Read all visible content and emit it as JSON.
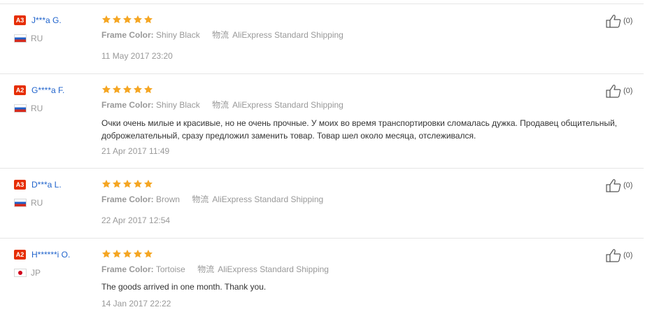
{
  "reviews": [
    {
      "level": "A3",
      "user": "J***a G.",
      "country": "RU",
      "flag_icon": "russia-flag-icon",
      "rating": 5,
      "attr_label": "Frame Color:",
      "attr_value": "Shiny Black",
      "shipping_label": "物流",
      "shipping_value": "AliExpress Standard Shipping",
      "text": "",
      "date": "11 May 2017 23:20",
      "helpful_count": "(0)"
    },
    {
      "level": "A2",
      "user": "G****a F.",
      "country": "RU",
      "flag_icon": "russia-flag-icon",
      "rating": 5,
      "attr_label": "Frame Color:",
      "attr_value": "Shiny Black",
      "shipping_label": "物流",
      "shipping_value": "AliExpress Standard Shipping",
      "text": "Очки очень милые и красивые, но не очень прочные. У моих во время транспортировки сломалась дужка. Продавец общительный, доброжелательный, сразу предложил заменить товар. Товар шел около месяца, отслеживался.",
      "date": "21 Apr 2017 11:49",
      "helpful_count": "(0)"
    },
    {
      "level": "A3",
      "user": "D***a L.",
      "country": "RU",
      "flag_icon": "russia-flag-icon",
      "rating": 5,
      "attr_label": "Frame Color:",
      "attr_value": "Brown",
      "shipping_label": "物流",
      "shipping_value": "AliExpress Standard Shipping",
      "text": "",
      "date": "22 Apr 2017 12:54",
      "helpful_count": "(0)"
    },
    {
      "level": "A2",
      "user": "H******i O.",
      "country": "JP",
      "flag_icon": "japan-flag-icon",
      "rating": 5,
      "attr_label": "Frame Color:",
      "attr_value": "Tortoise",
      "shipping_label": "物流",
      "shipping_value": "AliExpress Standard Shipping",
      "text": "The goods arrived in one month. Thank you.",
      "date": "14 Jan 2017 22:22",
      "helpful_count": "(0)"
    }
  ],
  "colors": {
    "badge": "#e62e04",
    "star": "#f5a623",
    "username": "#2164cc",
    "muted": "#999999",
    "text": "#333333"
  },
  "icons": {
    "star": "star-icon",
    "thumbs_up": "thumbs-up-icon"
  }
}
